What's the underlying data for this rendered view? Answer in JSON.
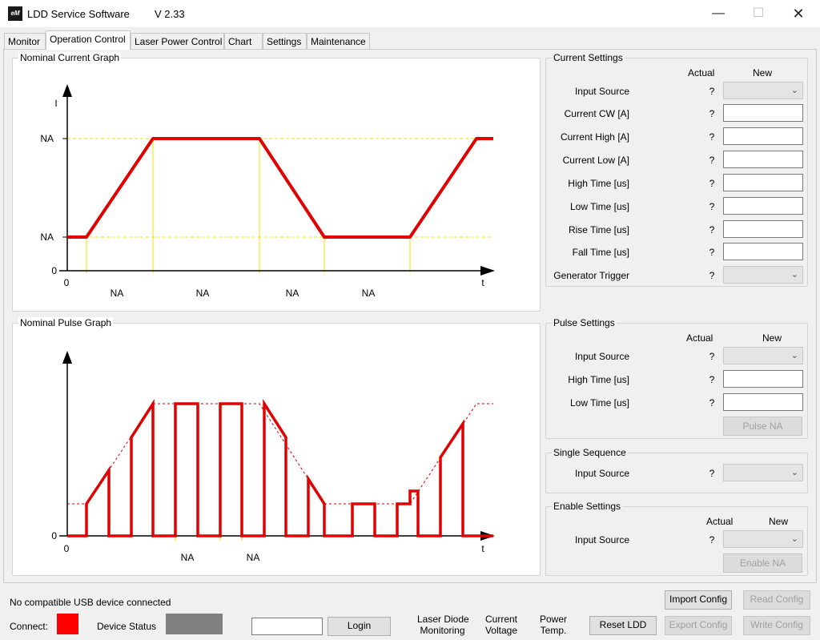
{
  "window": {
    "icon_text": "eM",
    "title": "LDD Service Software",
    "version": "V 2.33",
    "minimize": "—",
    "maximize": "☐",
    "close": "✕"
  },
  "tabs": [
    {
      "label": "Monitor"
    },
    {
      "label": "Operation Control"
    },
    {
      "label": "Laser Power Control"
    },
    {
      "label": "Chart"
    },
    {
      "label": "Settings"
    },
    {
      "label": "Maintenance"
    }
  ],
  "current_graph": {
    "title": "Nominal Current Graph",
    "y_axis_label": "I",
    "x_axis_label": "t",
    "y_high_label": "NA",
    "y_low_label": "NA",
    "y_zero_label": "0",
    "x_zero_label": "0",
    "segment_labels": [
      "NA",
      "NA",
      "NA",
      "NA"
    ]
  },
  "pulse_graph": {
    "title": "Nominal Pulse Graph",
    "x_axis_label": "t",
    "y_zero_label": "0",
    "x_zero_label": "0",
    "segment_labels": [
      "NA",
      "NA"
    ]
  },
  "current_settings": {
    "title": "Current Settings",
    "col_actual": "Actual",
    "col_new": "New",
    "rows": [
      {
        "label": "Input Source",
        "actual": "?",
        "type": "combo"
      },
      {
        "label": "Current CW [A]",
        "actual": "?",
        "type": "text"
      },
      {
        "label": "Current High [A]",
        "actual": "?",
        "type": "text"
      },
      {
        "label": "Current Low [A]",
        "actual": "?",
        "type": "text"
      },
      {
        "label": "High Time [us]",
        "actual": "?",
        "type": "text"
      },
      {
        "label": "Low Time [us]",
        "actual": "?",
        "type": "text"
      },
      {
        "label": "Rise Time [us]",
        "actual": "?",
        "type": "text"
      },
      {
        "label": "Fall Time [us]",
        "actual": "?",
        "type": "text"
      },
      {
        "label": "Generator Trigger",
        "actual": "?",
        "type": "combo"
      }
    ]
  },
  "pulse_settings": {
    "title": "Pulse Settings",
    "col_actual": "Actual",
    "col_new": "New",
    "rows": [
      {
        "label": "Input Source",
        "actual": "?",
        "type": "combo"
      },
      {
        "label": "High Time [us]",
        "actual": "?",
        "type": "text"
      },
      {
        "label": "Low Time [us]",
        "actual": "?",
        "type": "text"
      }
    ],
    "button": "Pulse NA"
  },
  "single_sequence": {
    "title": "Single Sequence",
    "row": {
      "label": "Input Source",
      "actual": "?"
    }
  },
  "enable_settings": {
    "title": "Enable Settings",
    "col_actual": "Actual",
    "col_new": "New",
    "row": {
      "label": "Input Source",
      "actual": "?"
    },
    "button": "Enable NA"
  },
  "status": {
    "usb_message": "No compatible USB device connected",
    "connect_label": "Connect:",
    "connect_color": "#ff0000",
    "device_status_label": "Device Status",
    "device_status_color": "#808080",
    "password_value": "",
    "login_button": "Login",
    "laser_diode_line1": "Laser Diode",
    "laser_diode_line2": "Monitoring",
    "current_voltage_line1": "Current",
    "current_voltage_line2": "Voltage",
    "power_temp_line1": "Power",
    "power_temp_line2": "Temp.",
    "reset_button": "Reset LDD",
    "import_button": "Import Config",
    "read_button": "Read Config",
    "export_button": "Export Config",
    "write_button": "Write Config"
  }
}
